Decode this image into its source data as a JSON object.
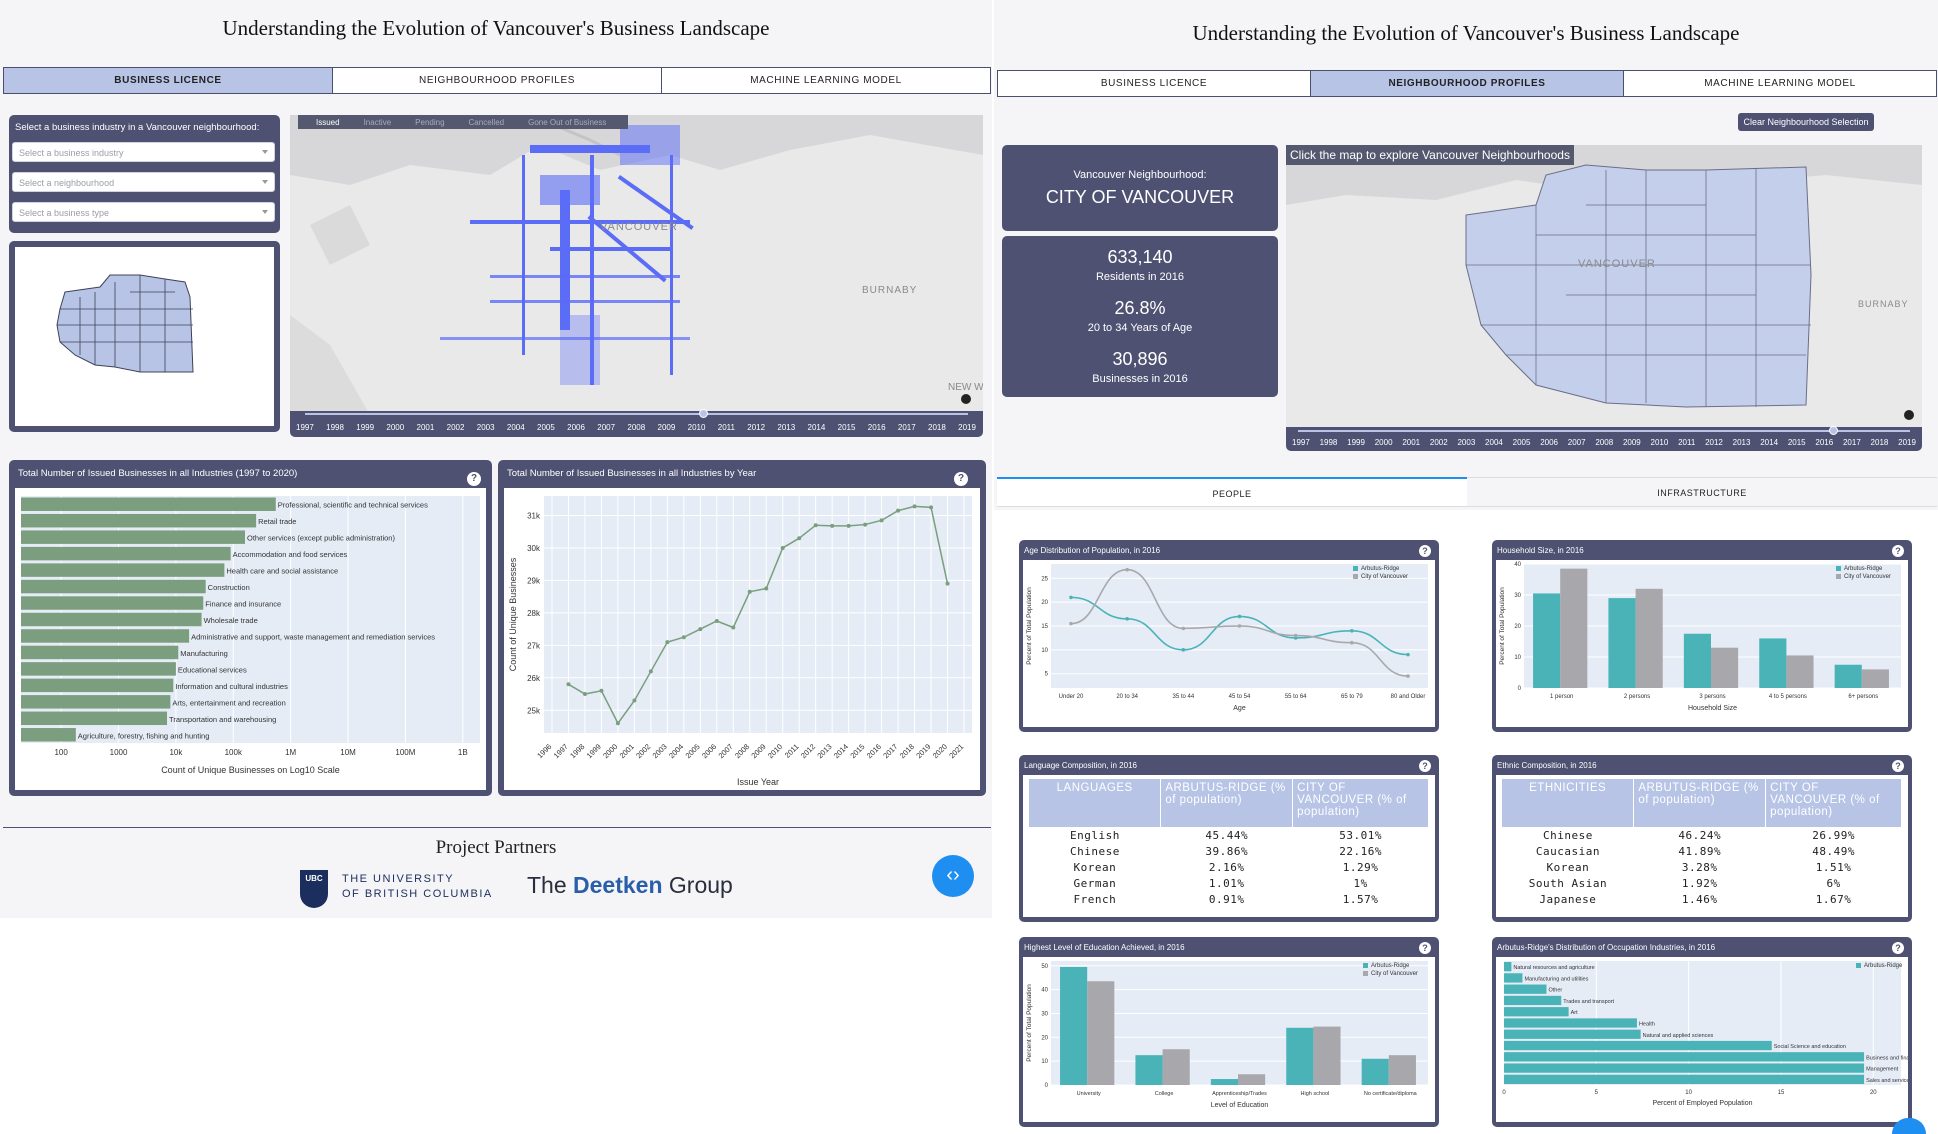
{
  "left": {
    "title": "Understanding the Evolution of Vancouver's Business Landscape",
    "tabs": [
      "BUSINESS LICENCE",
      "NEIGHBOURHOOD PROFILES",
      "MACHINE LEARNING MODEL"
    ],
    "filter_heading": "Select a business industry in a Vancouver neighbourhood:",
    "dropdowns": [
      "Select a business industry",
      "Select a neighbourhood",
      "Select a business type"
    ],
    "map_legend": [
      "Issued",
      "Inactive",
      "Pending",
      "Cancelled",
      "Gone Out of Business"
    ],
    "map_labels": [
      "VANCOUVER",
      "BURNABY",
      "NEW W"
    ],
    "years": [
      "1997",
      "1998",
      "1999",
      "2000",
      "2001",
      "2002",
      "2003",
      "2004",
      "2005",
      "2006",
      "2007",
      "2008",
      "2009",
      "2010",
      "2011",
      "2012",
      "2013",
      "2014",
      "2015",
      "2016",
      "2017",
      "2018",
      "2019"
    ],
    "partners_title": "Project Partners",
    "ubc_line1": "THE UNIVERSITY",
    "ubc_line2": "OF BRITISH COLUMBIA",
    "ubc_mark": "UBC",
    "deetken_1": "The ",
    "deetken_2": "Deetken",
    "deetken_3": " Group",
    "code_icon": "‹›"
  },
  "right": {
    "title": "Understanding the Evolution of Vancouver's Business Landscape",
    "tabs": [
      "BUSINESS LICENCE",
      "NEIGHBOURHOOD PROFILES",
      "MACHINE LEARNING MODEL"
    ],
    "clear_button": "Clear Neighbourhood Selection",
    "nb_label": "Vancouver Neighbourhood:",
    "nb_name": "CITY OF VANCOUVER",
    "stats": [
      {
        "value": "633,140",
        "label": "Residents in 2016"
      },
      {
        "value": "26.8%",
        "label": "20 to 34 Years of Age"
      },
      {
        "value": "30,896",
        "label": "Businesses in 2016"
      }
    ],
    "map_hint": "Click the map to explore Vancouver Neighbourhoods",
    "map_labels": [
      "VANCOUVER",
      "BURNABY"
    ],
    "years": [
      "1997",
      "1998",
      "1999",
      "2000",
      "2001",
      "2002",
      "2003",
      "2004",
      "2005",
      "2006",
      "2007",
      "2008",
      "2009",
      "2010",
      "2011",
      "2012",
      "2013",
      "2014",
      "2015",
      "2016",
      "2017",
      "2018",
      "2019"
    ],
    "subtabs": [
      "PEOPLE",
      "INFRASTRUCTURE"
    ],
    "language": {
      "title": "Language Composition, in 2016",
      "headers": [
        "LANGUAGES",
        "ARBUTUS-RIDGE (% of population)",
        "CITY OF VANCOUVER (% of population)"
      ],
      "rows": [
        [
          "English",
          "45.44%",
          "53.01%"
        ],
        [
          "Chinese",
          "39.86%",
          "22.16%"
        ],
        [
          "Korean",
          "2.16%",
          "1.29%"
        ],
        [
          "German",
          "1.01%",
          "1%"
        ],
        [
          "French",
          "0.91%",
          "1.57%"
        ]
      ]
    },
    "ethnic": {
      "title": "Ethnic Composition, in 2016",
      "headers": [
        "ETHNICITIES",
        "ARBUTUS-RIDGE (% of population)",
        "CITY OF VANCOUVER (% of population)"
      ],
      "rows": [
        [
          "Chinese",
          "46.24%",
          "26.99%"
        ],
        [
          "Caucasian",
          "41.89%",
          "48.49%"
        ],
        [
          "Korean",
          "3.28%",
          "1.51%"
        ],
        [
          "South Asian",
          "1.92%",
          "6%"
        ],
        [
          "Japanese",
          "1.46%",
          "1.67%"
        ]
      ]
    }
  },
  "chart_data": [
    {
      "type": "bar",
      "orientation": "horizontal",
      "title": "Total Number of Issued Businesses in all Industries (1997 to 2020)",
      "xlabel": "Count of Unique Businesses on Log10 Scale",
      "xscale": "log",
      "xticks": [
        "100",
        "1000",
        "10k",
        "100k",
        "1M",
        "10M",
        "100M",
        "1B"
      ],
      "categories": [
        "Professional, scientific and technical services",
        "Retail trade",
        "Other services (except public administration)",
        "Accommodation and food services",
        "Health care and social assistance",
        "Construction",
        "Finance and insurance",
        "Wholesale trade",
        "Administrative and support, waste management and remediation services",
        "Manufacturing",
        "Educational services",
        "Information and cultural industries",
        "Arts, entertainment and recreation",
        "Transportation and warehousing",
        "Agriculture, forestry, fishing and hunting"
      ],
      "values": [
        550000,
        250000,
        160000,
        90000,
        70000,
        33000,
        30000,
        28000,
        17000,
        11000,
        10000,
        9000,
        8000,
        7000,
        180
      ],
      "color": "#7a9e7e"
    },
    {
      "type": "line",
      "title": "Total Number of Issued Businesses in all Industries by Year",
      "xlabel": "Issue Year",
      "ylabel": "Count of Unique Businesses",
      "yticks": [
        "25k",
        "26k",
        "27k",
        "28k",
        "29k",
        "30k",
        "31k"
      ],
      "x": [
        "1996",
        "1997",
        "1998",
        "1999",
        "2000",
        "2001",
        "2002",
        "2003",
        "2004",
        "2005",
        "2006",
        "2007",
        "2008",
        "2009",
        "2010",
        "2011",
        "2012",
        "2013",
        "2014",
        "2015",
        "2016",
        "2017",
        "2018",
        "2019",
        "2020",
        "2021"
      ],
      "points": [
        [
          "1997",
          25800
        ],
        [
          "1998",
          25500
        ],
        [
          "1999",
          25600
        ],
        [
          "2000",
          24600
        ],
        [
          "2001",
          25300
        ],
        [
          "2002",
          26200
        ],
        [
          "2003",
          27100
        ],
        [
          "2004",
          27250
        ],
        [
          "2005",
          27500
        ],
        [
          "2006",
          27750
        ],
        [
          "2007",
          27550
        ],
        [
          "2008",
          28650
        ],
        [
          "2009",
          28750
        ],
        [
          "2010",
          30000
        ],
        [
          "2011",
          30300
        ],
        [
          "2012",
          30700
        ],
        [
          "2013",
          30680
        ],
        [
          "2014",
          30680
        ],
        [
          "2015",
          30720
        ],
        [
          "2016",
          30850
        ],
        [
          "2017",
          31150
        ],
        [
          "2018",
          31280
        ],
        [
          "2019",
          31250
        ],
        [
          "2020",
          28900
        ]
      ],
      "ylim": [
        24300,
        31600
      ],
      "color": "#7a9e7e"
    },
    {
      "type": "line",
      "title": "Age Distribution of Population, in 2016",
      "xlabel": "Age",
      "ylabel": "Percent of Total Population",
      "categories": [
        "Under 20",
        "20 to 34",
        "35 to 44",
        "45 to 54",
        "55 to 64",
        "65 to 79",
        "80 and Older"
      ],
      "yticks": [
        "5",
        "10",
        "15",
        "20",
        "25"
      ],
      "ylim": [
        2,
        28
      ],
      "series": [
        {
          "name": "Arbutus-Ridge",
          "values": [
            21,
            16.5,
            10,
            17,
            12.5,
            14,
            9
          ],
          "color": "#49b3b8"
        },
        {
          "name": "City of Vancouver",
          "values": [
            15.5,
            26.8,
            14.5,
            15,
            13,
            11.5,
            4.5
          ],
          "color": "#a8a8ac"
        }
      ],
      "legend": "top-right"
    },
    {
      "type": "bar",
      "title": "Household Size, in 2016",
      "xlabel": "Household Size",
      "ylabel": "Percent of Total Population",
      "categories": [
        "1 person",
        "2 persons",
        "3 persons",
        "4 to 5 persons",
        "6+ persons"
      ],
      "yticks": [
        "0",
        "10",
        "20",
        "30",
        "40"
      ],
      "ylim": [
        0,
        40
      ],
      "series": [
        {
          "name": "Arbutus-Ridge",
          "values": [
            30.5,
            29,
            17.5,
            16,
            7.5
          ],
          "color": "#49b3b8"
        },
        {
          "name": "City of Vancouver",
          "values": [
            38.5,
            32,
            13,
            10.5,
            6
          ],
          "color": "#a8a8ac"
        }
      ],
      "legend": "top-right"
    },
    {
      "type": "bar",
      "title": "Highest Level of Education Achieved, in 2016",
      "xlabel": "Level of Education",
      "ylabel": "Percent of Total Population",
      "categories": [
        "University",
        "College",
        "Apprenticeship/Trades",
        "High school",
        "No certificate/diploma"
      ],
      "yticks": [
        "0",
        "10",
        "20",
        "30",
        "40",
        "50"
      ],
      "ylim": [
        0,
        52
      ],
      "series": [
        {
          "name": "Arbutus-Ridge",
          "values": [
            49.5,
            12.5,
            2.5,
            24,
            11
          ],
          "color": "#49b3b8"
        },
        {
          "name": "City of Vancouver",
          "values": [
            43.5,
            15,
            4.5,
            24.5,
            12.5
          ],
          "color": "#a8a8ac"
        }
      ],
      "legend": "top-right"
    },
    {
      "type": "bar",
      "orientation": "horizontal",
      "title": "Arbutus-Ridge's Distribution of Occupation Industries, in 2016",
      "xlabel": "Percent of Employed Population",
      "xticks": [
        "0",
        "5",
        "10",
        "15",
        "20"
      ],
      "xlim": [
        0,
        21.5
      ],
      "categories": [
        "Natural resources and agriculture",
        "Manufacturing and utilities",
        "Other",
        "Trades and transport",
        "Art",
        "Health",
        "Natural and applied sciences",
        "Social Science and education",
        "Business and finance",
        "Management",
        "Sales and service"
      ],
      "series": [
        {
          "name": "Arbutus-Ridge",
          "values": [
            0.4,
            1,
            2.3,
            3.1,
            3.5,
            7.2,
            7.4,
            14.5,
            19.5,
            19.5,
            19.5
          ],
          "color": "#49b3b8"
        }
      ],
      "legend": "top-right"
    }
  ]
}
